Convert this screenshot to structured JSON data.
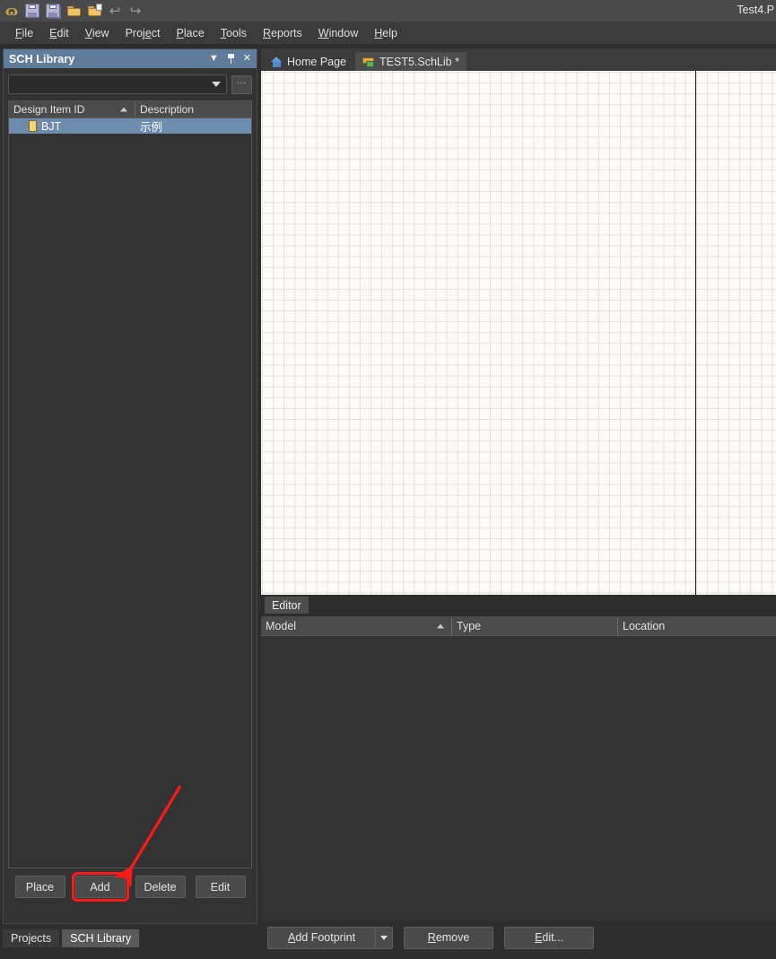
{
  "window": {
    "title": "Test4.P"
  },
  "toolbar": {
    "icons": [
      {
        "name": "altium-logo-icon",
        "glyph": "ɷ"
      },
      {
        "name": "save-icon"
      },
      {
        "name": "save-all-icon"
      },
      {
        "name": "open-folder-icon"
      },
      {
        "name": "open-document-icon"
      },
      {
        "name": "undo-icon",
        "glyph": "↶"
      },
      {
        "name": "redo-icon",
        "glyph": "↷"
      }
    ]
  },
  "menubar": {
    "items": [
      {
        "pre": "",
        "hot": "F",
        "post": "ile"
      },
      {
        "pre": "",
        "hot": "E",
        "post": "dit"
      },
      {
        "pre": "",
        "hot": "V",
        "post": "iew"
      },
      {
        "pre": "Proj",
        "hot": "e",
        "post": "ct"
      },
      {
        "pre": "",
        "hot": "P",
        "post": "lace"
      },
      {
        "pre": "",
        "hot": "T",
        "post": "ools"
      },
      {
        "pre": "",
        "hot": "R",
        "post": "eports"
      },
      {
        "pre": "",
        "hot": "W",
        "post": "indow"
      },
      {
        "pre": "",
        "hot": "H",
        "post": "elp"
      }
    ]
  },
  "sch_library_panel": {
    "title": "SCH Library",
    "header_buttons": [
      {
        "name": "panel-menu-dropdown",
        "label": "▼"
      },
      {
        "name": "panel-pin-icon",
        "label": ""
      },
      {
        "name": "panel-close-icon",
        "label": "✕"
      }
    ],
    "filter_combo": {
      "value": "",
      "placeholder": ""
    },
    "browse_button_label": "...",
    "components_grid": {
      "columns": [
        "Design Item ID",
        "Description"
      ],
      "sorted_column": "Design Item ID",
      "sort_direction": "ascending",
      "rows": [
        {
          "design_item_id": "BJT",
          "description": "示例",
          "selected": true,
          "icon": "component-chip-icon"
        }
      ]
    },
    "action_buttons": [
      {
        "name": "place-button",
        "label": "Place",
        "highlighted": false
      },
      {
        "name": "add-button",
        "label": "Add",
        "highlighted": true
      },
      {
        "name": "delete-button",
        "label": "Delete",
        "highlighted": false
      },
      {
        "name": "edit-button",
        "label": "Edit",
        "highlighted": false
      }
    ],
    "panel_tabs": [
      {
        "name": "tab-projects",
        "label": "Projects",
        "active": false
      },
      {
        "name": "tab-sch-library",
        "label": "SCH Library",
        "active": true
      }
    ]
  },
  "document_tabs": [
    {
      "name": "tab-home-page",
      "label": "Home Page",
      "icon": "home-icon",
      "active": false
    },
    {
      "name": "tab-test5-schlib",
      "label": "TEST5.SchLib *",
      "icon": "schlib-icon",
      "active": true
    }
  ],
  "editor": {
    "tab_label": "Editor",
    "model_grid": {
      "columns": [
        "Model",
        "Type",
        "Location"
      ],
      "sorted_column": "Model",
      "sort_direction": "ascending",
      "rows": []
    },
    "buttons": [
      {
        "name": "add-footprint-button",
        "pre": "A",
        "hot": "",
        "label_pre": "A",
        "label_rest": "dd Footprint",
        "has_dropdown": true
      },
      {
        "name": "remove-button",
        "label_pre": "R",
        "label_rest": "emove",
        "has_dropdown": false
      },
      {
        "name": "edit-ellipsis-button",
        "label_pre": "E",
        "label_rest": "dit...",
        "has_dropdown": false
      }
    ]
  },
  "annotation": {
    "arrow_color": "#ff1a1a",
    "highlight_color": "#ff1a1a",
    "points_to": "add-button"
  },
  "colors": {
    "panel_header": "#5f7c9b",
    "selection": "#6d8cae",
    "canvas_background": "#fdfbf7",
    "grid_line": "#e3e1dd",
    "window_background": "#2e2e2e"
  }
}
